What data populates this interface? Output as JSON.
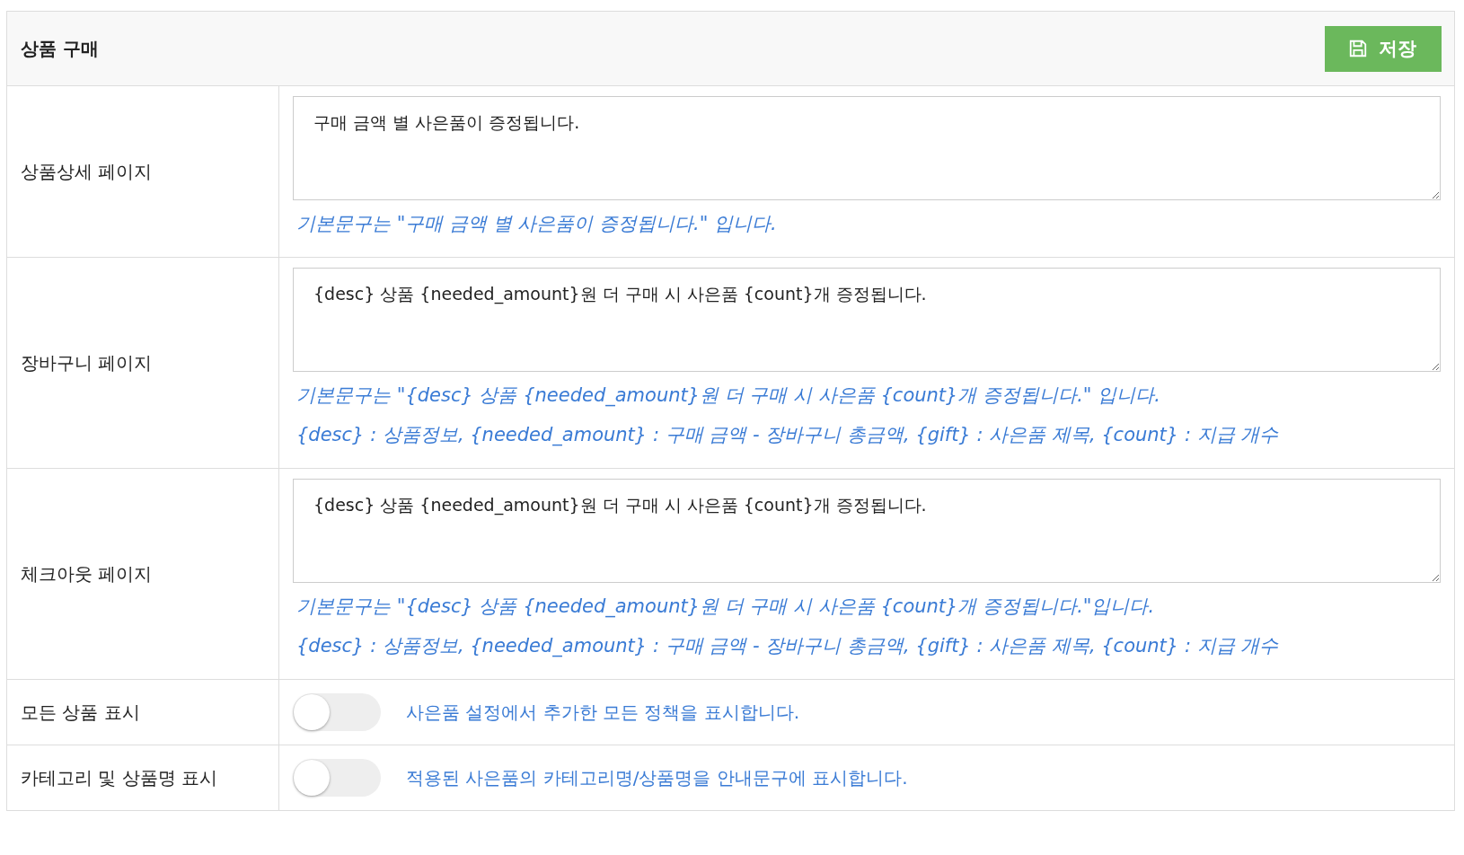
{
  "panel": {
    "title": "상품 구매",
    "save_button": {
      "label": "저장"
    }
  },
  "text_rows": [
    {
      "label": "상품상세 페이지",
      "value": "구매 금액 별 사은품이 증정됩니다.",
      "help": [
        "기본문구는 \"구매 금액 별 사은품이 증정됩니다.\" 입니다."
      ]
    },
    {
      "label": "장바구니 페이지",
      "value": "{desc} 상품 {needed_amount}원 더 구매 시 사은품 {count}개 증정됩니다.",
      "help": [
        "기본문구는 \"{desc} 상품 {needed_amount}원 더 구매 시 사은품 {count}개 증정됩니다.\" 입니다.",
        "{desc} : 상품정보, {needed_amount} : 구매 금액 - 장바구니 총금액, {gift} : 사은품 제목, {count} : 지급 개수"
      ]
    },
    {
      "label": "체크아웃 페이지",
      "value": "{desc} 상품 {needed_amount}원 더 구매 시 사은품 {count}개 증정됩니다.",
      "help": [
        "기본문구는 \"{desc} 상품 {needed_amount}원 더 구매 시 사은품 {count}개 증정됩니다.\"입니다.",
        "{desc} : 상품정보, {needed_amount} : 구매 금액 - 장바구니 총금액, {gift} : 사은품 제목, {count} : 지급 개수"
      ]
    }
  ],
  "toggle_rows": [
    {
      "label": "모든 상품 표시",
      "on": false,
      "description": "사은품 설정에서 추가한 모든 정책을 표시합니다."
    },
    {
      "label": "카테고리 및 상품명 표시",
      "on": false,
      "description": "적용된 사은품의 카테고리명/상품명을 안내문구에 표시합니다."
    }
  ]
}
